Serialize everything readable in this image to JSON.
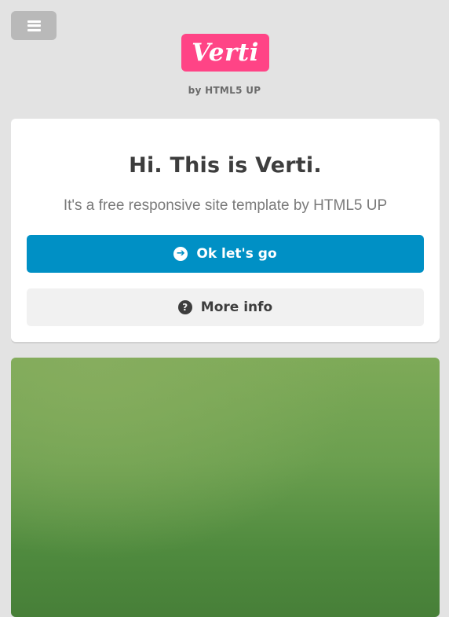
{
  "header": {
    "logo_text": "Verti",
    "byline": "by HTML5 UP",
    "menu_icon": "hamburger-icon"
  },
  "banner": {
    "title": "Hi. This is Verti.",
    "subtitle": "It's a free responsive site template by HTML5 UP",
    "primary_button": {
      "label": "Ok let's go",
      "icon": "arrow-circle-right-icon"
    },
    "secondary_button": {
      "label": "More info",
      "icon": "question-circle-icon"
    }
  },
  "colors": {
    "background": "#e3e3e3",
    "logo": "#ff4486",
    "primary_button": "#0090c5",
    "secondary_button": "#f1f1f1",
    "text_dark": "#3d3d3d",
    "image_green": "#6b9f4f"
  }
}
